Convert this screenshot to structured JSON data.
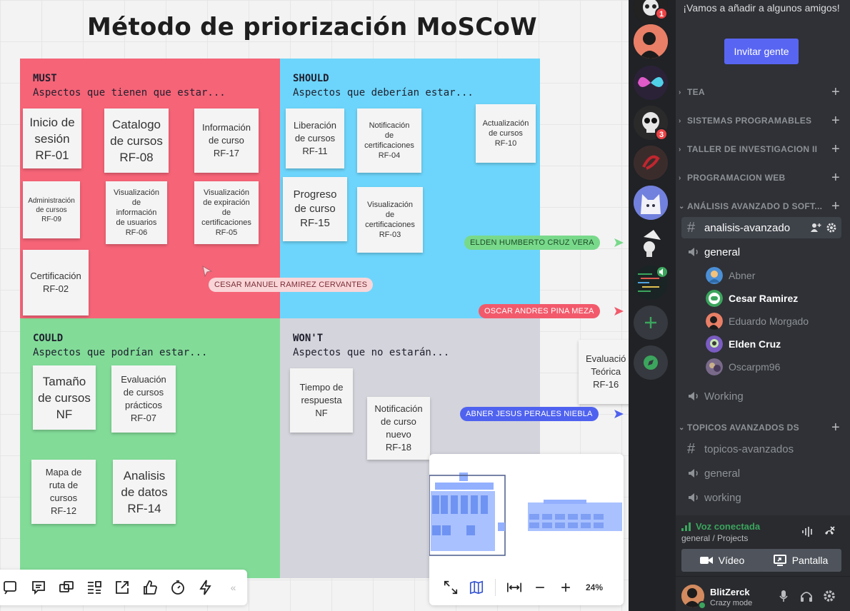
{
  "board": {
    "title": "Método de priorización MoSCoW",
    "quadrants": {
      "must": {
        "title": "MUST",
        "subtitle": "Aspectos que tienen que estar..."
      },
      "should": {
        "title": "SHOULD",
        "subtitle": "Aspectos que deberían estar..."
      },
      "could": {
        "title": "COULD",
        "subtitle": "Aspectos que podrían estar..."
      },
      "wont": {
        "title": "WON'T",
        "subtitle": "Aspectos que no estarán..."
      }
    },
    "notes": {
      "must": [
        "Inicio de\nsesión\nRF-01",
        "Catalogo\nde cursos\nRF-08",
        "Información\nde curso\nRF-17",
        "Administración\nde cursos\nRF-09",
        "Visualización\nde\ninformación\nde usuarios\nRF-06",
        "Visualización\nde expiración\nde\ncertificaciones\nRF-05",
        "Certificación\nRF-02"
      ],
      "should": [
        "Liberación\nde cursos\nRF-11",
        "Notificación\nde\ncertificaciones\nRF-04",
        "Actualización\nde cursos\nRF-10",
        "Progreso\nde curso\nRF-15",
        "Visualización\nde\ncertificaciones\nRF-03"
      ],
      "could": [
        "Tamaño\nde cursos\nNF",
        "Evaluación\nde cursos\nprácticos\nRF-07",
        "Mapa de\nruta de\ncursos\nRF-12",
        "Analisis\nde datos\nRF-14"
      ],
      "wont": [
        "Tiempo de\nrespuesta\nNF",
        "Notificación\nde curso\nnuevo\nRF-18"
      ],
      "outside": [
        "Evaluació\nTeórica\nRF-16"
      ]
    },
    "cursors": [
      {
        "name": "CESAR MANUEL RAMIREZ CERVANTES",
        "color": "#f9d5d8",
        "text_color": "#7a2e36"
      },
      {
        "name": "ELDEN HUMBERTO CRUZ VERA",
        "color": "#78d98b",
        "text_color": "#1d4d27"
      },
      {
        "name": "OSCAR ANDRES PINA MEZA",
        "color": "#f25a6b",
        "text_color": "#ffffff"
      },
      {
        "name": "ABNER JESUS PERALES NIEBLA",
        "color": "#4f62ef",
        "text_color": "#ffffff"
      }
    ],
    "toolbar_icons": [
      "frame-icon",
      "comment-icon",
      "video-chat-icon",
      "cards-icon",
      "share-icon",
      "vote-icon",
      "timer-icon",
      "bolt-icon"
    ],
    "zoom": "24%"
  },
  "discord": {
    "invite_text": "¡Vamos a añadir a algunos amigos!",
    "invite_button": "Invitar gente",
    "guild_badges": [
      "1",
      "3"
    ],
    "categories": {
      "tea": "TEA",
      "sistemas": "SISTEMAS PROGRAMABLES",
      "taller": "TALLER DE INVESTIGACION II",
      "web": "PROGRAMACION WEB",
      "analisis": "ANÁLISIS AVANZADO D SOFT...",
      "topicos": "TOPICOS AVANZADOS DS"
    },
    "channels": {
      "analisis_text": "analisis-avanzado",
      "general_voice": "general",
      "working_voice": "Working",
      "topicos_text": "topicos-avanzados",
      "topicos_general": "general",
      "topicos_working": "working"
    },
    "voice_users": [
      "Abner",
      "Cesar Ramirez",
      "Eduardo Morgado",
      "Elden Cruz",
      "Oscarpm96"
    ],
    "voice_panel": {
      "status": "Voz conectada",
      "location": "general / Projects",
      "video": "Vídeo",
      "screen": "Pantalla"
    },
    "user": {
      "name": "BlitZerck",
      "status": "Crazy mode"
    },
    "colors": {
      "accent": "#5865f2",
      "green": "#3ba55d",
      "badge": "#ed4245"
    }
  }
}
